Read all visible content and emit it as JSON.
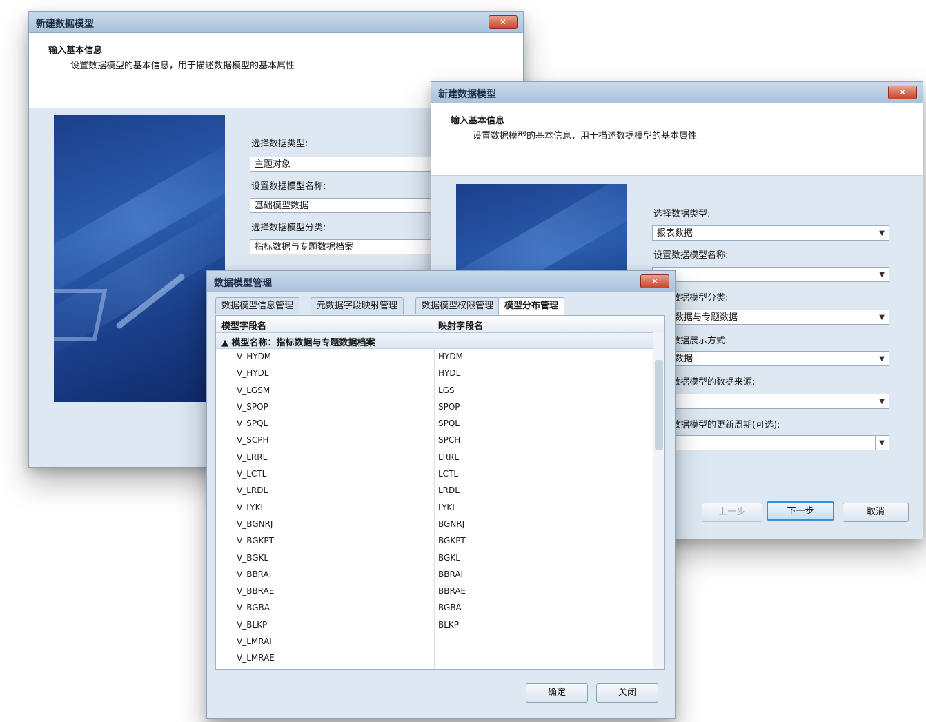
{
  "wizard_back": {
    "title": "新建数据模型",
    "close_label": "✕",
    "header_title": "输入基本信息",
    "header_desc": "设置数据模型的基本信息，用于描述数据模型的基本属性",
    "fields": [
      {
        "label": "选择数据类型:",
        "value": "主题对象"
      },
      {
        "label": "设置数据模型名称:",
        "value": "基础模型数据"
      },
      {
        "label": "选择数据模型分类:",
        "value": "指标数据与专题数据档案"
      }
    ]
  },
  "wizard_front": {
    "title": "新建数据模型",
    "close_label": "✕",
    "header_title": "输入基本信息",
    "header_desc": "设置数据模型的基本信息，用于描述数据模型的基本属性",
    "fields": [
      {
        "label": "选择数据类型:",
        "value": "报表数据"
      },
      {
        "label": "设置数据模型名称:",
        "value": ""
      },
      {
        "label": "选择数据模型分类:",
        "value": "指标数据与专题数据"
      },
      {
        "label": "选择数据展示方式:",
        "value": "列表数据"
      },
      {
        "label": "选择数据模型的数据来源:",
        "value": ""
      },
      {
        "label": "选择数据模型的更新周期(可选):",
        "value": ""
      }
    ],
    "buttons": {
      "back": "上一步",
      "next": "下一步",
      "cancel": "取消"
    }
  },
  "manager": {
    "title": "数据模型管理",
    "close_label": "✕",
    "tabs": [
      "数据模型信息管理",
      "元数据字段映射管理",
      "数据模型权限管理",
      "模型分布管理"
    ],
    "columns": [
      "模型字段名",
      "映射字段名"
    ],
    "group_label": "▲ 模型名称：指标数据与专题数据档案",
    "rows": [
      [
        "V_HYDM",
        "HYDM"
      ],
      [
        "V_HYDL",
        "HYDL"
      ],
      [
        "V_LGSM",
        "LGS"
      ],
      [
        "V_SPOP",
        "SPOP"
      ],
      [
        "V_SPQL",
        "SPQL"
      ],
      [
        "V_SCPH",
        "SPCH"
      ],
      [
        "V_LRRL",
        "LRRL"
      ],
      [
        "V_LCTL",
        "LCTL"
      ],
      [
        "V_LRDL",
        "LRDL"
      ],
      [
        "V_LYKL",
        "LYKL"
      ],
      [
        "V_BGNRJ",
        "BGNRJ"
      ],
      [
        "V_BGKPT",
        "BGKPT"
      ],
      [
        "V_BGKL",
        "BGKL"
      ],
      [
        "V_BBRAI",
        "BBRAI"
      ],
      [
        "V_BBRAE",
        "BBRAE"
      ],
      [
        "V_BGBA",
        "BGBA"
      ],
      [
        "V_BLKP",
        "BLKP"
      ],
      [
        "V_LMRAI",
        ""
      ],
      [
        "V_LMRAE",
        ""
      ]
    ],
    "buttons": {
      "ok": "确定",
      "close": "关闭"
    }
  }
}
